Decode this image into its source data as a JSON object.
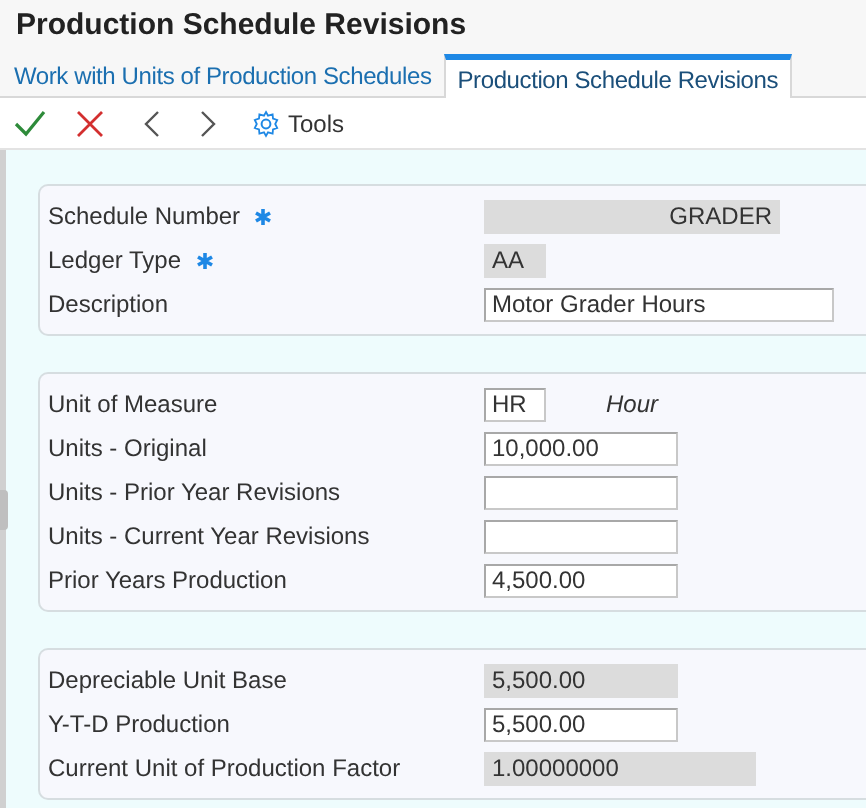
{
  "window": {
    "title": "Production Schedule Revisions"
  },
  "tabs": [
    {
      "label": "Work with Units of Production Schedules",
      "selected": false
    },
    {
      "label": "Production Schedule Revisions",
      "selected": true
    }
  ],
  "toolbar": {
    "tools_label": "Tools"
  },
  "sections": [
    {
      "fields": [
        {
          "label": "Schedule Number",
          "required": true,
          "kind": "readonly",
          "value": "GRADER"
        },
        {
          "label": "Ledger Type",
          "required": true,
          "kind": "readonly",
          "value": "AA"
        },
        {
          "label": "Description",
          "required": false,
          "kind": "input",
          "value": "Motor Grader Hours"
        }
      ]
    },
    {
      "fields": [
        {
          "label": "Unit of Measure",
          "required": false,
          "kind": "input",
          "value": "HR",
          "note": "Hour"
        },
        {
          "label": "Units - Original",
          "required": false,
          "kind": "input",
          "value": "10,000.00"
        },
        {
          "label": "Units - Prior Year Revisions",
          "required": false,
          "kind": "input"
        },
        {
          "label": "Units - Current Year Revisions",
          "required": false,
          "kind": "input"
        },
        {
          "label": "Prior Years Production",
          "required": false,
          "kind": "input",
          "value": "4,500.00"
        }
      ]
    },
    {
      "fields": [
        {
          "label": "Depreciable Unit Base",
          "required": false,
          "kind": "readonly",
          "value": "5,500.00"
        },
        {
          "label": "Y-T-D Production",
          "required": false,
          "kind": "input",
          "value": "5,500.00"
        },
        {
          "label": "Current Unit of Production Factor",
          "required": false,
          "kind": "readonly",
          "value": "1.00000000"
        }
      ]
    }
  ]
}
